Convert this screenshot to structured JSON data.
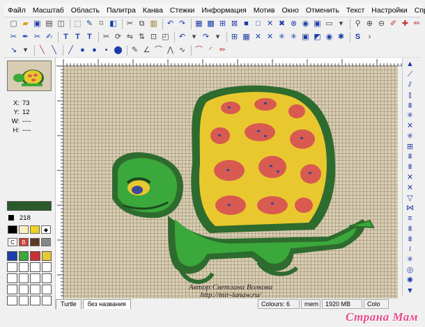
{
  "menu": [
    "Файл",
    "Масштаб",
    "Область",
    "Палитра",
    "Канва",
    "Стежки",
    "Информация",
    "Мотив",
    "Окно",
    "Отменить",
    "Текст",
    "Настройки",
    "Справка"
  ],
  "toolbar1": [
    "new-icon",
    "open-icon",
    "save-icon",
    "print-icon",
    "preview-icon",
    "select-rect-icon",
    "select-free-icon",
    "lasso-icon",
    "fill-icon",
    "cut-icon",
    "copy-icon",
    "paste-icon",
    "undo-icon",
    "grid-icon",
    "zoom-in-icon",
    "zoom-out-icon",
    "eyedropper-icon",
    "pencil-icon"
  ],
  "toolbar2": [
    "text-icon",
    "font-icon",
    "rotate-icon",
    "flip-icon",
    "mirror-icon",
    "undo-arrow-icon",
    "redo-arrow-icon",
    "stitch-icon",
    "backstitch-icon",
    "special-icon"
  ],
  "toolbar3": [
    "arrow-icon",
    "line-icon",
    "brush-icon",
    "dot-icon",
    "curve-icon",
    "ellipse-icon"
  ],
  "left": {
    "coords": [
      {
        "label": "X:",
        "value": "73"
      },
      {
        "label": "Y:",
        "value": "12"
      },
      {
        "label": "W:",
        "value": "----"
      },
      {
        "label": "H:",
        "value": "----"
      }
    ],
    "color_number": "218",
    "palette_labels": [
      "C",
      "B",
      "",
      ""
    ]
  },
  "credit": {
    "line1": "Автор:Светлана Волкова",
    "line2": "http://mir-lanaw.ru/"
  },
  "tabs": [
    "Turtle",
    "без названия"
  ],
  "status": {
    "colours": "Colours: 6",
    "mem_label": "mem",
    "memory": "1920 MB",
    "extra": "Colo"
  },
  "watermark": "Страна Мам",
  "colors": {
    "canvas": "#d8cdb2",
    "shell_yellow": "#e8c82e",
    "shell_dark": "#2e6b2e",
    "body_green": "#3aa83a",
    "spot_red": "#d85a50",
    "accent_blue": "#1c3ea8"
  }
}
